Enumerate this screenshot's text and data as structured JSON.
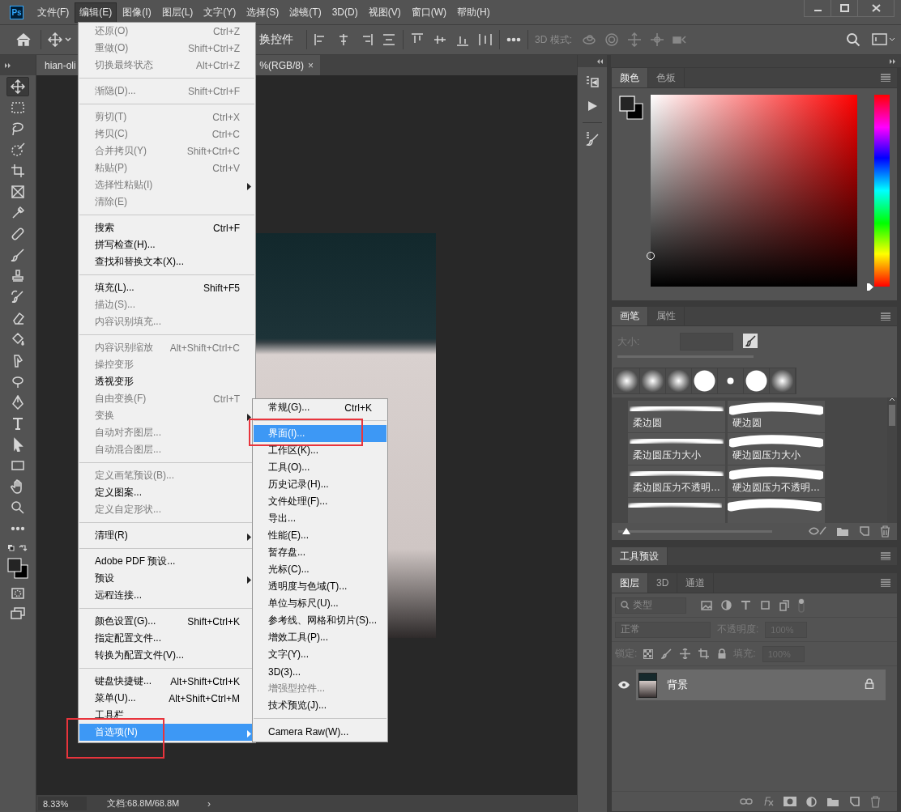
{
  "app": {
    "logo": "Ps"
  },
  "menu_bar": [
    {
      "label": "文件(F)",
      "selected": false
    },
    {
      "label": "编辑(E)",
      "selected": true
    },
    {
      "label": "图像(I)",
      "selected": false
    },
    {
      "label": "图层(L)",
      "selected": false
    },
    {
      "label": "文字(Y)",
      "selected": false
    },
    {
      "label": "选择(S)",
      "selected": false
    },
    {
      "label": "滤镜(T)",
      "selected": false
    },
    {
      "label": "3D(D)",
      "selected": false
    },
    {
      "label": "视图(V)",
      "selected": false
    },
    {
      "label": "窗口(W)",
      "selected": false
    },
    {
      "label": "帮助(H)",
      "selected": false
    }
  ],
  "options_bar": {
    "partial_label": "换控件",
    "mode_label": "3D 模式:"
  },
  "document_tab": {
    "title_start": "hian-oli",
    "title_end": "%(RGB/8)",
    "close": "×"
  },
  "tools": [
    {
      "selected": true
    },
    {
      "selected": false
    },
    {
      "selected": false
    },
    {
      "selected": false
    },
    {
      "selected": false
    },
    {
      "selected": false
    },
    {
      "selected": false
    },
    {
      "selected": false
    },
    {
      "selected": false
    },
    {
      "selected": false
    },
    {
      "selected": false
    },
    {
      "selected": false
    },
    {
      "selected": false
    },
    {
      "selected": false
    },
    {
      "selected": false
    },
    {
      "selected": false
    },
    {
      "selected": false
    },
    {
      "selected": false
    },
    {
      "selected": false
    },
    {
      "selected": false
    },
    {
      "selected": false
    },
    {
      "selected": false
    }
  ],
  "edit_menu": [
    [
      {
        "label": "还原(O)",
        "shortcut": "Ctrl+Z",
        "disabled": true,
        "submenu": false,
        "selected": false,
        "annotated": false
      },
      {
        "label": "重做(O)",
        "shortcut": "Shift+Ctrl+Z",
        "disabled": true,
        "submenu": false,
        "selected": false,
        "annotated": false
      },
      {
        "label": "切换最终状态",
        "shortcut": "Alt+Ctrl+Z",
        "disabled": true,
        "submenu": false,
        "selected": false,
        "annotated": false
      }
    ],
    [
      {
        "label": "渐隐(D)...",
        "shortcut": "Shift+Ctrl+F",
        "disabled": true,
        "submenu": false,
        "selected": false,
        "annotated": false
      }
    ],
    [
      {
        "label": "剪切(T)",
        "shortcut": "Ctrl+X",
        "disabled": true,
        "submenu": false,
        "selected": false,
        "annotated": false
      },
      {
        "label": "拷贝(C)",
        "shortcut": "Ctrl+C",
        "disabled": true,
        "submenu": false,
        "selected": false,
        "annotated": false
      },
      {
        "label": "合并拷贝(Y)",
        "shortcut": "Shift+Ctrl+C",
        "disabled": true,
        "submenu": false,
        "selected": false,
        "annotated": false
      },
      {
        "label": "粘贴(P)",
        "shortcut": "Ctrl+V",
        "disabled": true,
        "submenu": false,
        "selected": false,
        "annotated": false
      },
      {
        "label": "选择性粘贴(I)",
        "disabled": true,
        "submenu": true,
        "selected": false,
        "annotated": false
      },
      {
        "label": "清除(E)",
        "disabled": true,
        "submenu": false,
        "selected": false,
        "annotated": false
      }
    ],
    [
      {
        "label": "搜索",
        "shortcut": "Ctrl+F",
        "disabled": false,
        "submenu": false,
        "selected": false,
        "annotated": false
      },
      {
        "label": "拼写检查(H)...",
        "disabled": false,
        "submenu": false,
        "selected": false,
        "annotated": false
      },
      {
        "label": "查找和替换文本(X)...",
        "disabled": false,
        "submenu": false,
        "selected": false,
        "annotated": false
      }
    ],
    [
      {
        "label": "填充(L)...",
        "shortcut": "Shift+F5",
        "disabled": false,
        "submenu": false,
        "selected": false,
        "annotated": false
      },
      {
        "label": "描边(S)...",
        "disabled": true,
        "submenu": false,
        "selected": false,
        "annotated": false
      },
      {
        "label": "内容识别填充...",
        "disabled": true,
        "submenu": false,
        "selected": false,
        "annotated": false
      }
    ],
    [
      {
        "label": "内容识别缩放",
        "shortcut": "Alt+Shift+Ctrl+C",
        "disabled": true,
        "submenu": false,
        "selected": false,
        "annotated": false
      },
      {
        "label": "操控变形",
        "disabled": true,
        "submenu": false,
        "selected": false,
        "annotated": false
      },
      {
        "label": "透视变形",
        "disabled": false,
        "submenu": false,
        "selected": false,
        "annotated": false
      },
      {
        "label": "自由变换(F)",
        "shortcut": "Ctrl+T",
        "disabled": true,
        "submenu": false,
        "selected": false,
        "annotated": false
      },
      {
        "label": "变换",
        "disabled": true,
        "submenu": true,
        "selected": false,
        "annotated": false
      },
      {
        "label": "自动对齐图层...",
        "disabled": true,
        "submenu": false,
        "selected": false,
        "annotated": false
      },
      {
        "label": "自动混合图层...",
        "disabled": true,
        "submenu": false,
        "selected": false,
        "annotated": false
      }
    ],
    [
      {
        "label": "定义画笔预设(B)...",
        "disabled": true,
        "submenu": false,
        "selected": false,
        "annotated": false
      },
      {
        "label": "定义图案...",
        "disabled": false,
        "submenu": false,
        "selected": false,
        "annotated": false
      },
      {
        "label": "定义自定形状...",
        "disabled": true,
        "submenu": false,
        "selected": false,
        "annotated": false
      }
    ],
    [
      {
        "label": "清理(R)",
        "disabled": false,
        "submenu": true,
        "selected": false,
        "annotated": false
      }
    ],
    [
      {
        "label": "Adobe PDF 预设...",
        "disabled": false,
        "submenu": false,
        "selected": false,
        "annotated": false
      },
      {
        "label": "预设",
        "disabled": false,
        "submenu": true,
        "selected": false,
        "annotated": false
      },
      {
        "label": "远程连接...",
        "disabled": false,
        "submenu": false,
        "selected": false,
        "annotated": false
      }
    ],
    [
      {
        "label": "颜色设置(G)...",
        "shortcut": "Shift+Ctrl+K",
        "disabled": false,
        "submenu": false,
        "selected": false,
        "annotated": false
      },
      {
        "label": "指定配置文件...",
        "disabled": false,
        "submenu": false,
        "selected": false,
        "annotated": false
      },
      {
        "label": "转换为配置文件(V)...",
        "disabled": false,
        "submenu": false,
        "selected": false,
        "annotated": false
      }
    ],
    [
      {
        "label": "键盘快捷键...",
        "shortcut": "Alt+Shift+Ctrl+K",
        "disabled": false,
        "submenu": false,
        "selected": false,
        "annotated": false
      },
      {
        "label": "菜单(U)...",
        "shortcut": "Alt+Shift+Ctrl+M",
        "disabled": false,
        "submenu": false,
        "selected": false,
        "annotated": false
      },
      {
        "label": "工具栏",
        "disabled": false,
        "submenu": false,
        "selected": false,
        "annotated": false
      },
      {
        "label": "首选项(N)",
        "disabled": false,
        "submenu": true,
        "selected": true,
        "annotated": true
      }
    ]
  ],
  "preferences_submenu": [
    [
      {
        "label": "常规(G)...",
        "shortcut": "Ctrl+K",
        "disabled": false,
        "submenu": false,
        "selected": false,
        "annotated": false
      }
    ],
    [
      {
        "label": "界面(I)...",
        "disabled": false,
        "submenu": false,
        "selected": true,
        "annotated": true
      },
      {
        "label": "工作区(K)...",
        "disabled": false,
        "submenu": false,
        "selected": false,
        "annotated": false
      },
      {
        "label": "工具(O)...",
        "disabled": false,
        "submenu": false,
        "selected": false,
        "annotated": false
      },
      {
        "label": "历史记录(H)...",
        "disabled": false,
        "submenu": false,
        "selected": false,
        "annotated": false
      },
      {
        "label": "文件处理(F)...",
        "disabled": false,
        "submenu": false,
        "selected": false,
        "annotated": false
      },
      {
        "label": "导出...",
        "disabled": false,
        "submenu": false,
        "selected": false,
        "annotated": false
      },
      {
        "label": "性能(E)...",
        "disabled": false,
        "submenu": false,
        "selected": false,
        "annotated": false
      },
      {
        "label": "暂存盘...",
        "disabled": false,
        "submenu": false,
        "selected": false,
        "annotated": false
      },
      {
        "label": "光标(C)...",
        "disabled": false,
        "submenu": false,
        "selected": false,
        "annotated": false
      },
      {
        "label": "透明度与色域(T)...",
        "disabled": false,
        "submenu": false,
        "selected": false,
        "annotated": false
      },
      {
        "label": "单位与标尺(U)...",
        "disabled": false,
        "submenu": false,
        "selected": false,
        "annotated": false
      },
      {
        "label": "参考线、网格和切片(S)...",
        "disabled": false,
        "submenu": false,
        "selected": false,
        "annotated": false
      },
      {
        "label": "增效工具(P)...",
        "disabled": false,
        "submenu": false,
        "selected": false,
        "annotated": false
      },
      {
        "label": "文字(Y)...",
        "disabled": false,
        "submenu": false,
        "selected": false,
        "annotated": false
      },
      {
        "label": "3D(3)...",
        "disabled": false,
        "submenu": false,
        "selected": false,
        "annotated": false
      },
      {
        "label": "增强型控件...",
        "disabled": true,
        "submenu": false,
        "selected": false,
        "annotated": false
      },
      {
        "label": "技术预览(J)...",
        "disabled": false,
        "submenu": false,
        "selected": false,
        "annotated": false
      }
    ],
    [
      {
        "label": "Camera Raw(W)...",
        "disabled": false,
        "submenu": false,
        "selected": false,
        "annotated": false
      }
    ]
  ],
  "color_panel": {
    "tabs": [
      {
        "label": "颜色",
        "selected": true
      },
      {
        "label": "色板",
        "selected": false
      }
    ],
    "hue_slider": {
      "level": 0
    }
  },
  "brush_panel": {
    "tabs": [
      {
        "label": "画笔",
        "selected": true
      },
      {
        "label": "属性",
        "selected": false
      }
    ],
    "size_label": "大小:",
    "preview_slider": {
      "level": 0.05
    },
    "presets": [
      {
        "label": "柔边圆",
        "kind": "soft"
      },
      {
        "label": "硬边圆",
        "kind": "hard"
      },
      {
        "label": "柔边圆压力大小",
        "kind": "soft"
      },
      {
        "label": "硬边圆压力大小",
        "kind": "hard"
      },
      {
        "label": "柔边圆压力不透明…",
        "kind": "soft"
      },
      {
        "label": "硬边圆压力不透明…",
        "kind": "hard"
      }
    ]
  },
  "tool_presets_panel": {
    "tabs": [
      {
        "label": "工具预设",
        "selected": true
      }
    ]
  },
  "layers_panel": {
    "tabs": [
      {
        "label": "图层",
        "selected": true
      },
      {
        "label": "3D",
        "selected": false
      },
      {
        "label": "通道",
        "selected": false
      }
    ],
    "filter_kind": "类型",
    "blend_mode": "正常",
    "opacity_label": "不透明度:",
    "opacity": "100%",
    "lock_label": "锁定:",
    "fill_label": "填充:",
    "fill": "100%",
    "layers": [
      {
        "name": "背景",
        "visible": true,
        "locked": true,
        "selected": true
      }
    ]
  },
  "status_bar": {
    "zoom": "8.33%",
    "doc_info": "文档:68.8M/68.8M",
    "expand": "›"
  }
}
